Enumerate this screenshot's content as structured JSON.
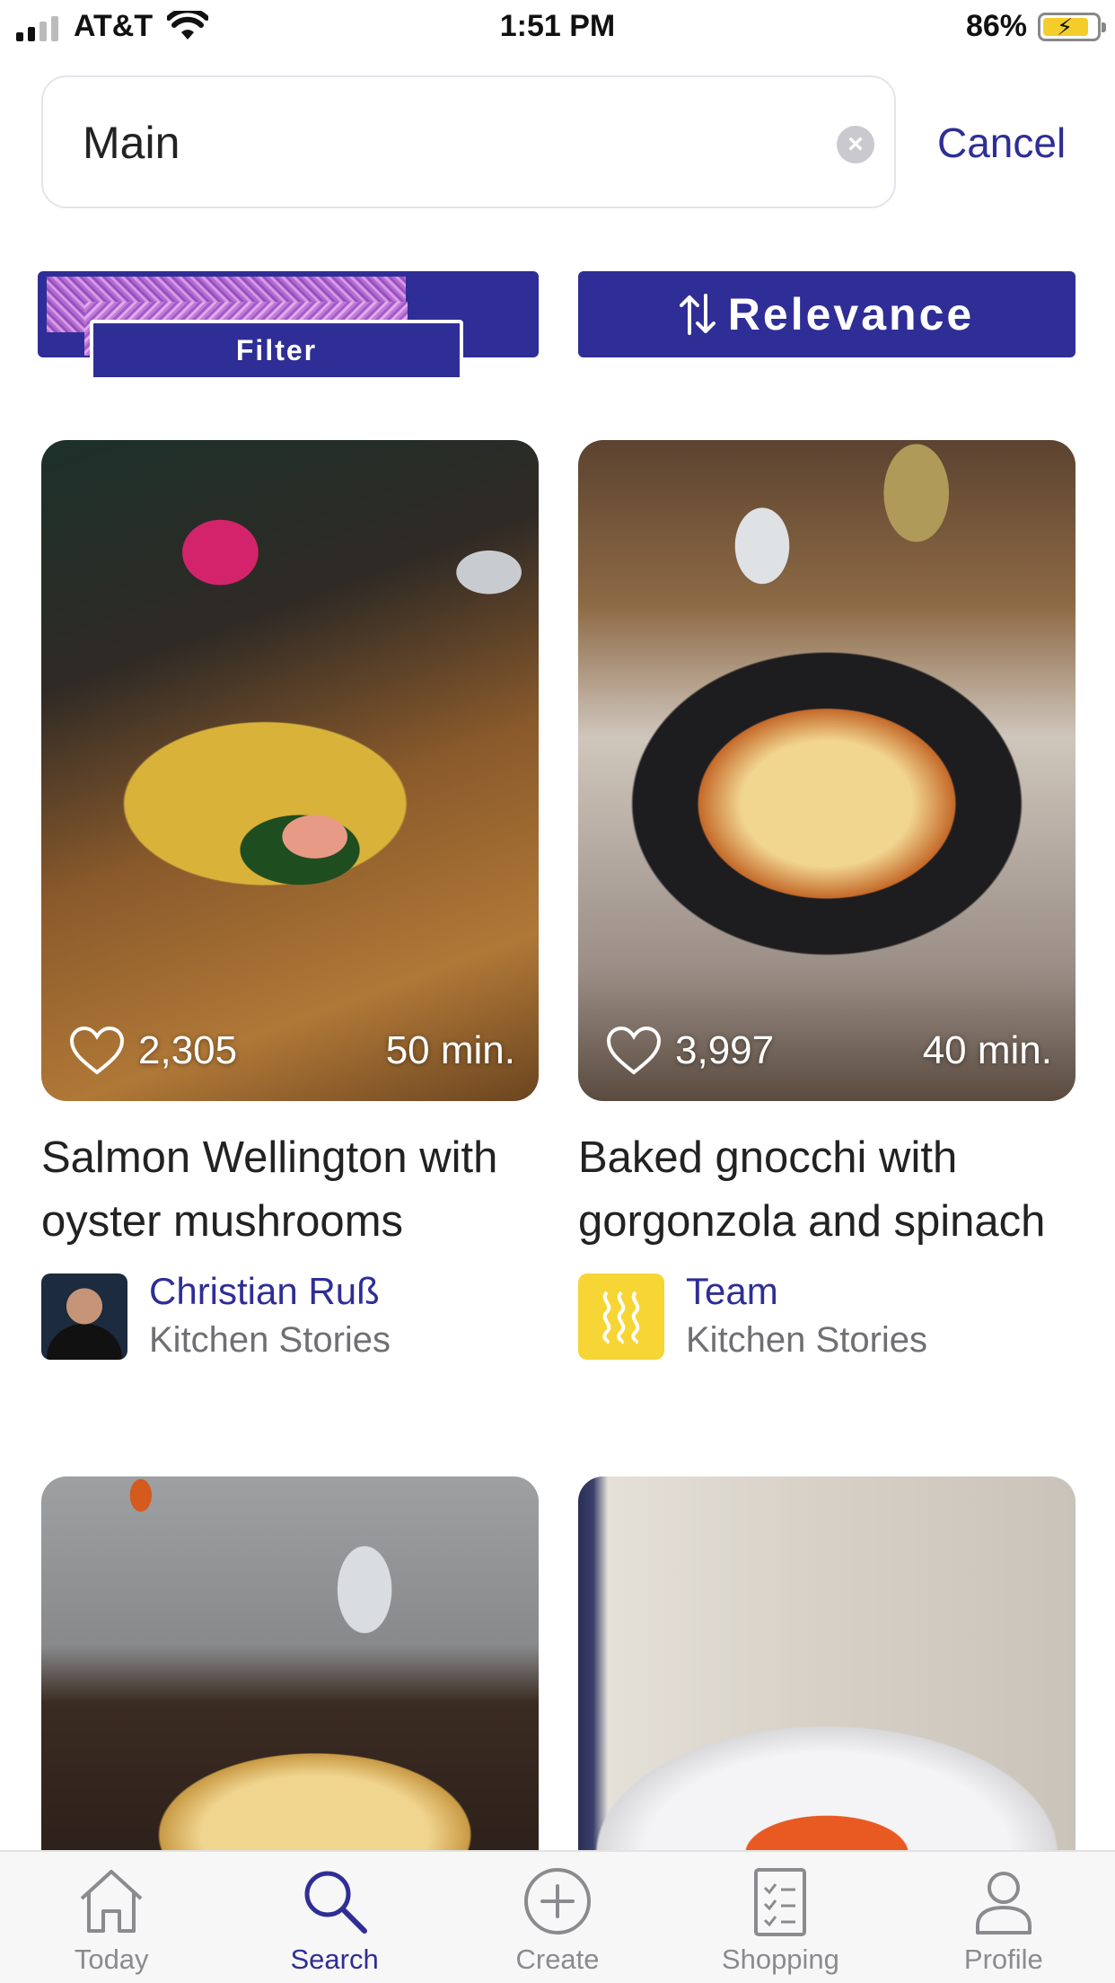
{
  "status_bar": {
    "carrier": "AT&T",
    "time": "1:51 PM",
    "battery": "86%"
  },
  "search": {
    "value": "Main",
    "cancel_label": "Cancel"
  },
  "toolbar": {
    "filter_label": "Filter",
    "sort_label": "Relevance",
    "sort_icon": "sort-arrows-icon"
  },
  "recipes": [
    {
      "likes": "2,305",
      "time": "50 min.",
      "title": "Salmon Wellington with oyster mushrooms",
      "author": "Christian Ruß",
      "source": "Kitchen Stories"
    },
    {
      "likes": "3,997",
      "time": "40 min.",
      "title": "Baked gnocchi with gorgonzola and spinach",
      "author": "Team",
      "source": "Kitchen Stories"
    },
    {},
    {}
  ],
  "tabs": [
    {
      "label": "Today",
      "icon": "house-icon"
    },
    {
      "label": "Search",
      "icon": "search-icon",
      "active": true
    },
    {
      "label": "Create",
      "icon": "plus-circle-icon"
    },
    {
      "label": "Shopping",
      "icon": "checklist-icon"
    },
    {
      "label": "Profile",
      "icon": "person-icon"
    }
  ],
  "colors": {
    "accent": "#2f2e96",
    "muted": "#8b8b8f",
    "team_avatar": "#f6d535"
  }
}
